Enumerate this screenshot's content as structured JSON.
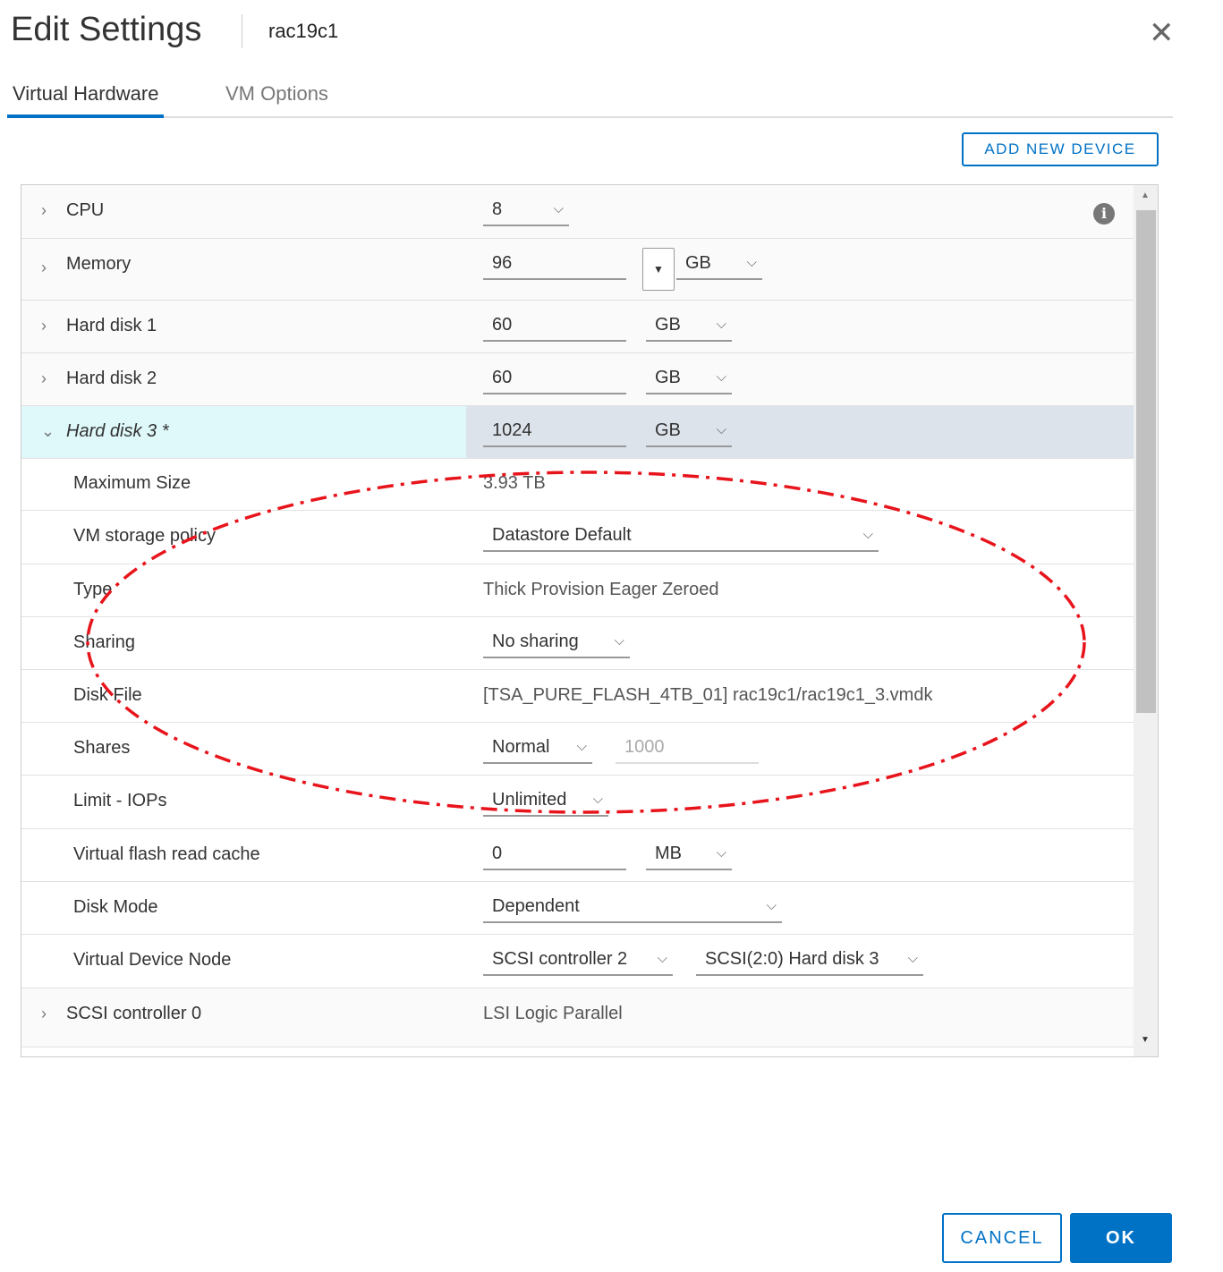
{
  "header": {
    "title": "Edit Settings",
    "vm_name": "rac19c1"
  },
  "tabs": [
    {
      "label": "Virtual Hardware",
      "active": true
    },
    {
      "label": "VM Options",
      "active": false
    }
  ],
  "add_new_device_label": "ADD NEW DEVICE",
  "hardware": {
    "cpu": {
      "label": "CPU",
      "value": "8"
    },
    "memory": {
      "label": "Memory",
      "value": "96",
      "unit": "GB"
    },
    "hd1": {
      "label": "Hard disk 1",
      "value": "60",
      "unit": "GB"
    },
    "hd2": {
      "label": "Hard disk 2",
      "value": "60",
      "unit": "GB"
    },
    "hd3": {
      "label": "Hard disk 3 *",
      "value": "1024",
      "unit": "GB"
    },
    "max_size": {
      "label": "Maximum Size",
      "value": "3.93 TB"
    },
    "storage_policy": {
      "label": "VM storage policy",
      "value": "Datastore Default"
    },
    "type": {
      "label": "Type",
      "value": "Thick Provision Eager Zeroed"
    },
    "sharing": {
      "label": "Sharing",
      "value": "No sharing"
    },
    "disk_file": {
      "label": "Disk File",
      "value": "[TSA_PURE_FLASH_4TB_01] rac19c1/rac19c1_3.vmdk"
    },
    "shares": {
      "label": "Shares",
      "value": "Normal",
      "amount": "1000"
    },
    "limit_iops": {
      "label": "Limit - IOPs",
      "value": "Unlimited"
    },
    "flash_cache": {
      "label": "Virtual flash read cache",
      "value": "0",
      "unit": "MB"
    },
    "disk_mode": {
      "label": "Disk Mode",
      "value": "Dependent"
    },
    "device_node": {
      "label": "Virtual Device Node",
      "controller": "SCSI controller 2",
      "node": "SCSI(2:0) Hard disk 3"
    },
    "scsi0": {
      "label": "SCSI controller 0",
      "value": "LSI Logic Parallel"
    }
  },
  "footer": {
    "cancel_label": "CANCEL",
    "ok_label": "OK"
  },
  "colors": {
    "accent": "#0072c6",
    "annotation": "#e8141c"
  }
}
